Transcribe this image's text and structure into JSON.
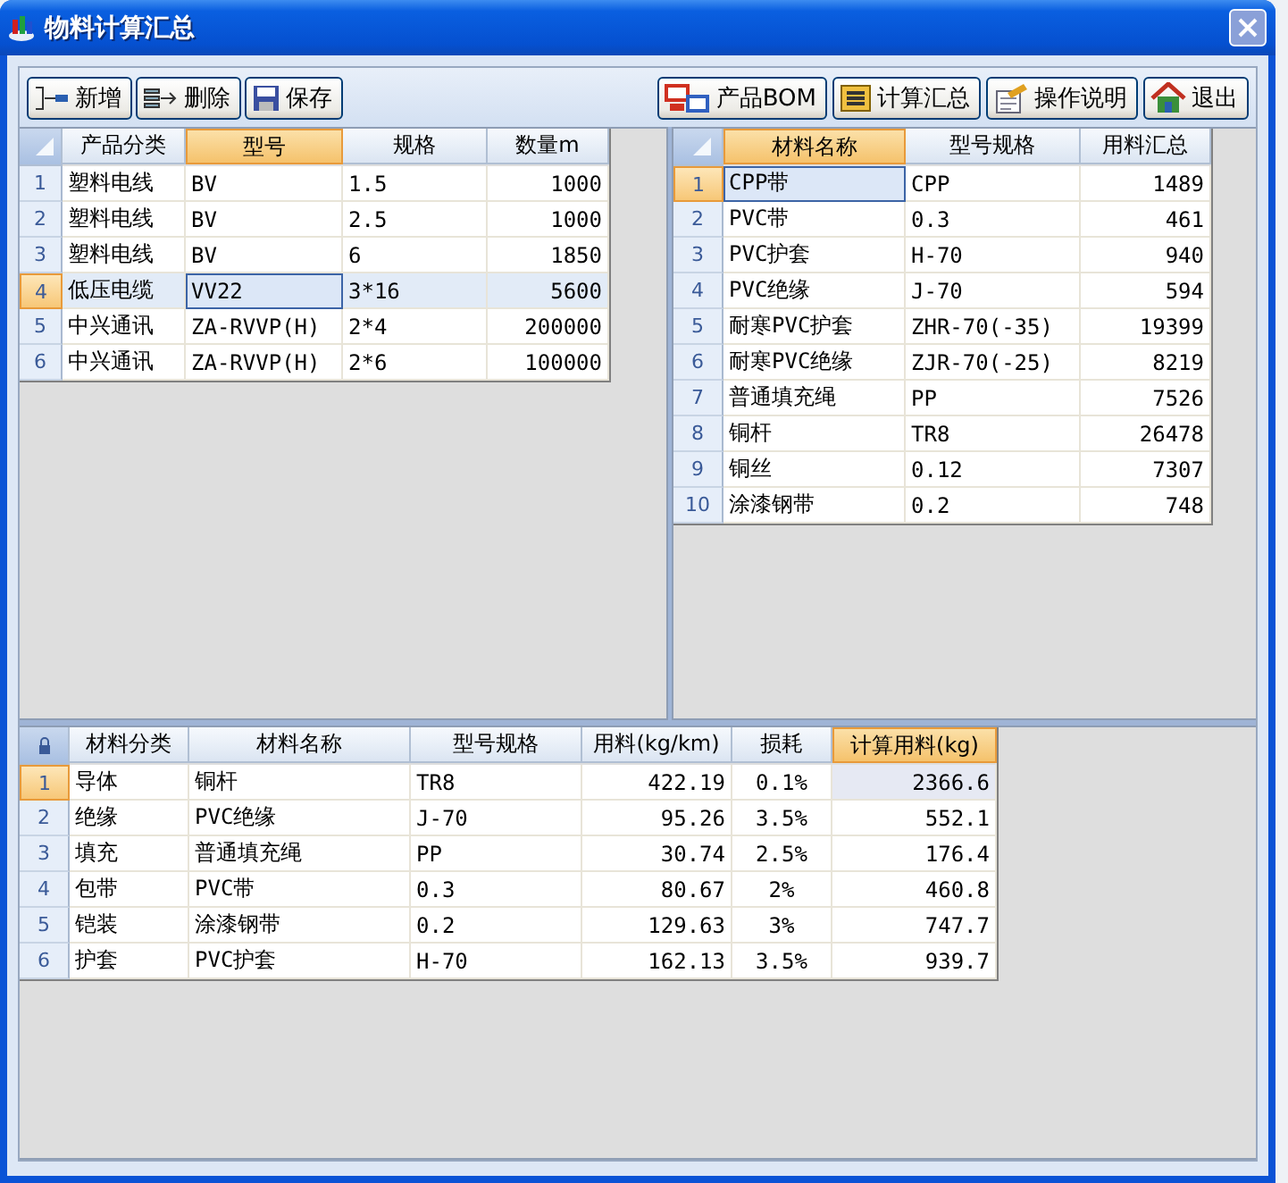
{
  "window": {
    "title": "物料计算汇总"
  },
  "toolbar_left": [
    {
      "label": "新增",
      "kind": "add"
    },
    {
      "label": "删除",
      "kind": "remove"
    },
    {
      "label": "保存",
      "kind": "save"
    }
  ],
  "toolbar_right": [
    {
      "label": "产品BOM",
      "kind": "bom"
    },
    {
      "label": "计算汇总",
      "kind": "sum"
    },
    {
      "label": "操作说明",
      "kind": "help"
    },
    {
      "label": "退出",
      "kind": "exit"
    }
  ],
  "product_table": {
    "columns": [
      {
        "label": "产品分类",
        "kind": "text",
        "selected": false
      },
      {
        "label": "型号",
        "kind": "text",
        "selected": true
      },
      {
        "label": "规格",
        "kind": "text",
        "selected": false
      },
      {
        "label": "数量m",
        "kind": "number",
        "selected": false
      }
    ],
    "rows": [
      {
        "number": "1",
        "selected": false,
        "cells": [
          "塑料电线",
          "BV",
          "1.5",
          "1000"
        ]
      },
      {
        "number": "2",
        "selected": false,
        "cells": [
          "塑料电线",
          "BV",
          "2.5",
          "1000"
        ]
      },
      {
        "number": "3",
        "selected": false,
        "cells": [
          "塑料电线",
          "BV",
          "6",
          "1850"
        ]
      },
      {
        "number": "4",
        "selected": true,
        "cells": [
          "低压电缆",
          "VV22",
          "3*16",
          "5600"
        ]
      },
      {
        "number": "5",
        "selected": false,
        "cells": [
          "中兴通讯",
          "ZA-RVVP(H)",
          "2*4",
          "200000"
        ]
      },
      {
        "number": "6",
        "selected": false,
        "cells": [
          "中兴通讯",
          "ZA-RVVP(H)",
          "2*6",
          "100000"
        ]
      }
    ]
  },
  "material_summary_table": {
    "columns": [
      {
        "label": "材料名称",
        "kind": "text",
        "selected": true
      },
      {
        "label": "型号规格",
        "kind": "text",
        "selected": false
      },
      {
        "label": "用料汇总",
        "kind": "number",
        "selected": false
      }
    ],
    "rows": [
      {
        "number": "1",
        "selected": true,
        "cells": [
          "CPP带",
          "CPP",
          "1489"
        ]
      },
      {
        "number": "2",
        "selected": false,
        "cells": [
          "PVC带",
          "0.3",
          "461"
        ]
      },
      {
        "number": "3",
        "selected": false,
        "cells": [
          "PVC护套",
          "H-70",
          "940"
        ]
      },
      {
        "number": "4",
        "selected": false,
        "cells": [
          "PVC绝缘",
          "J-70",
          "594"
        ]
      },
      {
        "number": "5",
        "selected": false,
        "cells": [
          "耐寒PVC护套",
          "ZHR-70(-35)",
          "19399"
        ]
      },
      {
        "number": "6",
        "selected": false,
        "cells": [
          "耐寒PVC绝缘",
          "ZJR-70(-25)",
          "8219"
        ]
      },
      {
        "number": "7",
        "selected": false,
        "cells": [
          "普通填充绳",
          "PP",
          "7526"
        ]
      },
      {
        "number": "8",
        "selected": false,
        "cells": [
          "铜杆",
          "TR8",
          "26478"
        ]
      },
      {
        "number": "9",
        "selected": false,
        "cells": [
          "铜丝",
          "0.12",
          "7307"
        ]
      },
      {
        "number": "10",
        "selected": false,
        "cells": [
          "涂漆钢带",
          "0.2",
          "748"
        ]
      }
    ]
  },
  "material_detail_table": {
    "columns": [
      {
        "label": "材料分类",
        "kind": "text",
        "selected": false
      },
      {
        "label": "材料名称",
        "kind": "text",
        "selected": false
      },
      {
        "label": "型号规格",
        "kind": "text",
        "selected": false
      },
      {
        "label": "用料(kg/km)",
        "kind": "number",
        "selected": false
      },
      {
        "label": "损耗",
        "kind": "ratio",
        "selected": false
      },
      {
        "label": "计算用料(kg)",
        "kind": "number",
        "selected": true
      }
    ],
    "rows": [
      {
        "number": "1",
        "selected": true,
        "cells": [
          "导体",
          "铜杆",
          "TR8",
          "422.19",
          "0.1%",
          "2366.6"
        ]
      },
      {
        "number": "2",
        "selected": false,
        "cells": [
          "绝缘",
          "PVC绝缘",
          "J-70",
          "95.26",
          "3.5%",
          "552.1"
        ]
      },
      {
        "number": "3",
        "selected": false,
        "cells": [
          "填充",
          "普通填充绳",
          "PP",
          "30.74",
          "2.5%",
          "176.4"
        ]
      },
      {
        "number": "4",
        "selected": false,
        "cells": [
          "包带",
          "PVC带",
          "0.3",
          "80.67",
          "2%",
          "460.8"
        ]
      },
      {
        "number": "5",
        "selected": false,
        "cells": [
          "铠装",
          "涂漆钢带",
          "0.2",
          "129.63",
          "3%",
          "747.7"
        ]
      },
      {
        "number": "6",
        "selected": false,
        "cells": [
          "护套",
          "PVC护套",
          "H-70",
          "162.13",
          "3.5%",
          "939.7"
        ]
      }
    ]
  }
}
